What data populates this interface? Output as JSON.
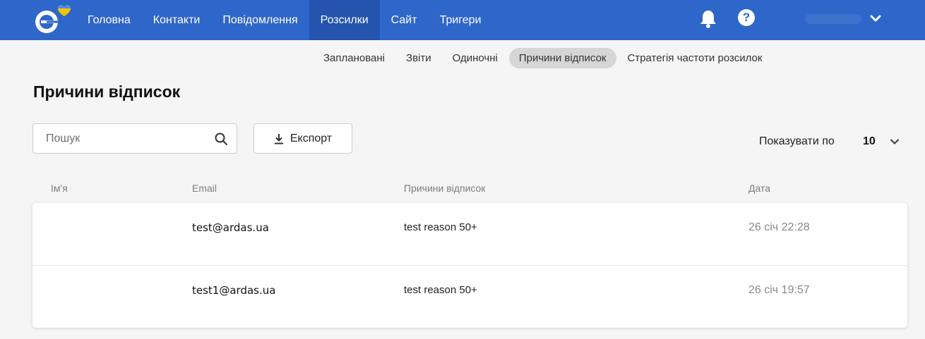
{
  "nav": {
    "items": [
      {
        "label": "Головна"
      },
      {
        "label": "Контакти"
      },
      {
        "label": "Повідомлення"
      },
      {
        "label": "Розсилки",
        "active": true
      },
      {
        "label": "Сайт"
      },
      {
        "label": "Тригери"
      }
    ],
    "help_label": "?"
  },
  "subtabs": [
    {
      "label": "Заплановані"
    },
    {
      "label": "Звіти"
    },
    {
      "label": "Одиночні"
    },
    {
      "label": "Причини відписок",
      "active": true
    },
    {
      "label": "Стратегія частоти розсилок"
    }
  ],
  "page": {
    "title": "Причини відписок"
  },
  "search": {
    "placeholder": "Пошук",
    "value": ""
  },
  "export": {
    "label": "Експорт"
  },
  "per_page": {
    "label": "Показувати по",
    "value": "10"
  },
  "table": {
    "columns": [
      "Ім'я",
      "Email",
      "Причини відписок",
      "Дата"
    ],
    "rows": [
      {
        "name": "",
        "email": "test@ardas.ua",
        "reason": "test reason 50+",
        "date": "26 січ 22:28"
      },
      {
        "name": "",
        "email": "test1@ardas.ua",
        "reason": "test reason 50+",
        "date": "26 січ 19:57"
      }
    ]
  },
  "colors": {
    "navbar": "#2f66c9",
    "navbar_active": "#2454ad",
    "subtab_active": "#d6d6d6",
    "background": "#f5f5f5"
  },
  "icons": [
    "logo-icon",
    "bell-icon",
    "help-icon",
    "chevron-down-icon",
    "search-icon",
    "download-icon"
  ]
}
